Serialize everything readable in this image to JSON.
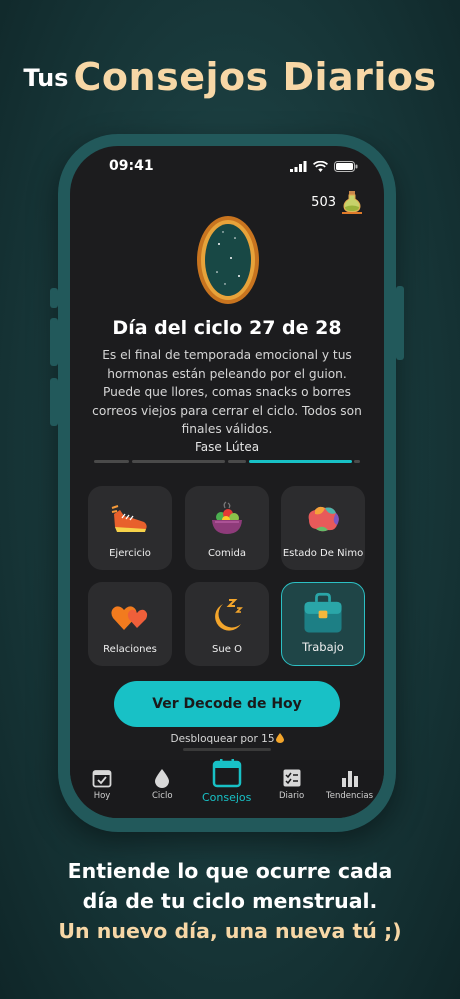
{
  "headline": {
    "small": "Tus",
    "big": "Consejos Diarios"
  },
  "status": {
    "time": "09:41"
  },
  "coins": {
    "count": "503"
  },
  "cycle": {
    "title": "Día del ciclo 27 de 28",
    "description": "Es el final de temporada emocional y tus hormonas están peleando por el guion. Puede que llores, comas snacks o borres correos viejos para cerrar el ciclo. Todos son finales válidos.",
    "phase": "Fase Lútea"
  },
  "cards": [
    {
      "label": "Ejercicio",
      "icon": "running-shoe-icon"
    },
    {
      "label": "Comida",
      "icon": "salad-bowl-icon"
    },
    {
      "label": "Estado De Nimo",
      "icon": "brain-icon"
    },
    {
      "label": "Relaciones",
      "icon": "hearts-icon"
    },
    {
      "label": "Sue O",
      "icon": "moon-sleep-icon"
    },
    {
      "label": "Trabajo",
      "icon": "briefcase-icon"
    }
  ],
  "cta": {
    "label": "Ver Decode de Hoy"
  },
  "unlock": {
    "text": "Desbloquear por 15"
  },
  "tabs": [
    {
      "label": "Hoy",
      "icon": "calendar-check-icon"
    },
    {
      "label": "Ciclo",
      "icon": "drop-icon"
    },
    {
      "label": "Consejos",
      "icon": "calendar-icon"
    },
    {
      "label": "Diario",
      "icon": "journal-icon"
    },
    {
      "label": "Tendencias",
      "icon": "bar-chart-icon"
    }
  ],
  "footer": {
    "line1": "Entiende lo que ocurre cada",
    "line2": "día de tu ciclo menstrual.",
    "line3": "Un nuevo día, una nueva tú ;)"
  },
  "colors": {
    "accent": "#18c1c6",
    "gold": "#f7d7a6",
    "phone": "#22595b"
  }
}
